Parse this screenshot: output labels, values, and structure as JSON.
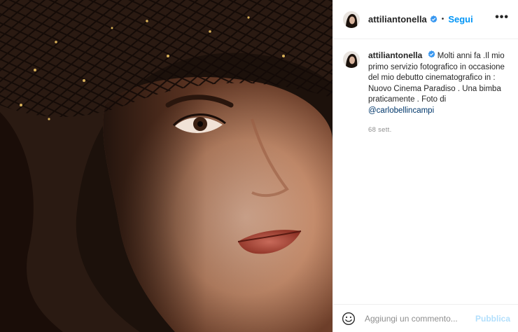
{
  "post": {
    "photo": {
      "icon": "portrait-photo"
    },
    "header": {
      "username": "attiliantonella",
      "verified_icon": "verified-badge-icon",
      "separator": "•",
      "follow_label": "Segui",
      "more_icon": "more-options-icon",
      "more_label": "•••"
    },
    "caption": {
      "username": "attiliantonella",
      "text": "Molti anni fa .Il mio primo servizio fotografico in occasione del mio debutto cinematografico in : Nuovo Cinema Paradiso . Una bimba praticamente . Foto di ",
      "mention": "@carlobellincampi",
      "timestamp": "68 sett."
    },
    "comment": {
      "emoji_icon": "emoji-icon",
      "placeholder": "Aggiungi un commento...",
      "publish_label": "Pubblica"
    },
    "colors": {
      "follow_blue": "#0095f6",
      "verified_blue": "#3897f0",
      "publish_disabled": "#b2dffc",
      "mention": "#00376b",
      "muted": "#8e8e8e"
    }
  }
}
